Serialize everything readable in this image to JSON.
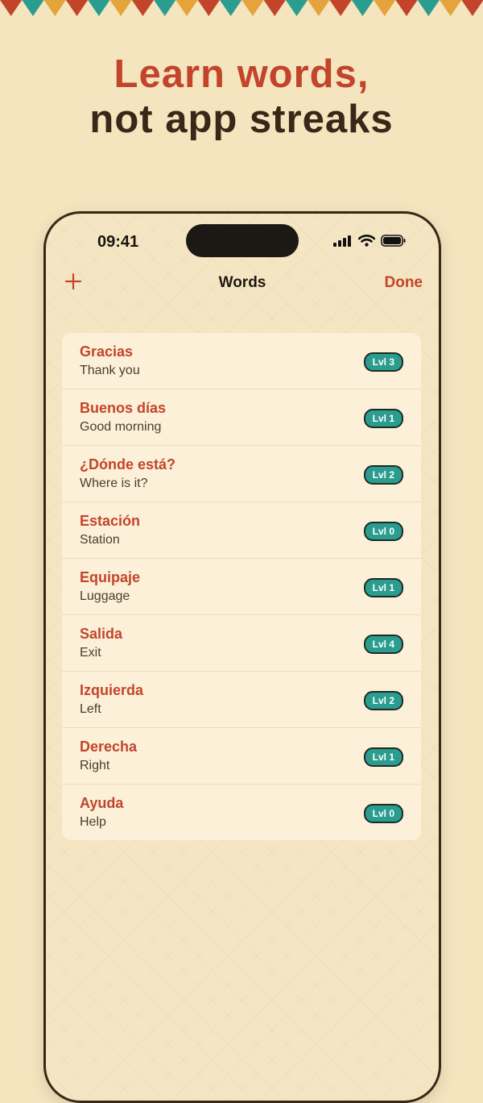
{
  "headline": {
    "line1": "Learn words,",
    "line2": "not app streaks"
  },
  "bunting_colors": [
    "#c2452b",
    "#2a9d8f",
    "#e5a43b"
  ],
  "status_bar": {
    "time": "09:41"
  },
  "nav": {
    "title": "Words",
    "done_label": "Done",
    "add_icon": "plus-icon"
  },
  "colors": {
    "accent": "#c2452b",
    "badge": "#2a9d8f",
    "background": "#f4e5bf"
  },
  "words": [
    {
      "word": "Gracias",
      "translation": "Thank you",
      "level": "Lvl 3"
    },
    {
      "word": "Buenos días",
      "translation": "Good morning",
      "level": "Lvl 1"
    },
    {
      "word": "¿Dónde está?",
      "translation": "Where is it?",
      "level": "Lvl 2"
    },
    {
      "word": "Estación",
      "translation": "Station",
      "level": "Lvl 0"
    },
    {
      "word": "Equipaje",
      "translation": "Luggage",
      "level": "Lvl 1"
    },
    {
      "word": "Salida",
      "translation": "Exit",
      "level": "Lvl 4"
    },
    {
      "word": "Izquierda",
      "translation": "Left",
      "level": "Lvl 2"
    },
    {
      "word": "Derecha",
      "translation": "Right",
      "level": "Lvl 1"
    },
    {
      "word": "Ayuda",
      "translation": "Help",
      "level": "Lvl 0"
    }
  ]
}
